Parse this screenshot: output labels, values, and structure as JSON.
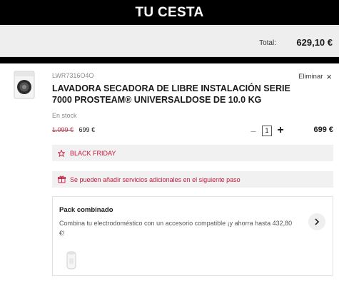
{
  "header": {
    "title": "TU CESTA"
  },
  "summary": {
    "total_label": "Total:",
    "total_value": "629,10 €"
  },
  "item": {
    "sku": "LWR7316O4O",
    "remove_label": "Eliminar",
    "name": "LAVADORA SECADORA DE LIBRE INSTALACIÓN SERIE 7000 PROSTEAM® UNIVERSALDOSE DE 10.0 KG",
    "stock": "En stock",
    "old_price": "1.099 €",
    "price": "699 €",
    "quantity": "1",
    "line_total": "699 €",
    "promo_black_friday": "BLACK FRIDAY",
    "services_note": "Se pueden añadir servicios adicionales en el siguiente paso"
  },
  "pack": {
    "title": "Pack combinado",
    "description": "Combina tu electrodoméstico con un accesorio compatible ¡y ahorra hasta 432,80 €!"
  },
  "colors": {
    "accent": "#c8163b",
    "header_bg": "#000000",
    "panel_bg": "#eeeeee"
  },
  "icons": [
    "washer-product-image",
    "close-icon",
    "minus-icon",
    "plus-icon",
    "star-icon",
    "gift-icon",
    "chevron-right-icon",
    "accessory-product-image"
  ]
}
